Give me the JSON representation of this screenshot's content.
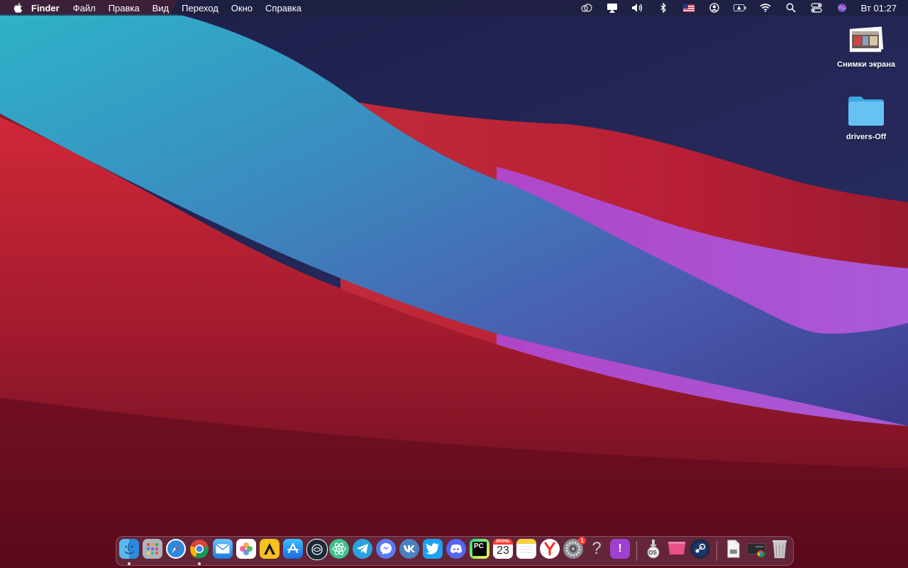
{
  "menubar": {
    "app_name": "Finder",
    "menus": [
      "Файл",
      "Правка",
      "Вид",
      "Переход",
      "Окно",
      "Справка"
    ],
    "status_icons": [
      "creative-cloud-icon",
      "airplay-icon",
      "volume-icon",
      "bluetooth-icon",
      "us-flag-icon",
      "user-icon",
      "battery-icon",
      "wifi-icon",
      "search-icon",
      "control-center-icon",
      "siri-icon"
    ],
    "clock": "Вт 01:27"
  },
  "desktop": {
    "items": [
      {
        "label": "Снимки экрана",
        "icon": "screenshot-stack-icon"
      },
      {
        "label": "drivers-Off",
        "icon": "folder-icon"
      }
    ]
  },
  "dock": {
    "apps": [
      "finder",
      "launchpad",
      "safari",
      "chrome",
      "mail",
      "photos",
      "artstudio",
      "app-store",
      "proxyman",
      "atom",
      "telegram",
      "messenger",
      "vk",
      "twitter",
      "discord",
      "pycharm",
      "calendar",
      "notes",
      "yandex-browser",
      "system-preferences",
      "help",
      "feedback"
    ],
    "calendar": {
      "month": "ИЮНЬ",
      "day": "23"
    },
    "pycharm_label": "PC",
    "system_prefs_badge": "1",
    "help_glyph": "?",
    "feedback_glyph": "!",
    "utilities": [
      "macos-installer",
      "cleanmymac",
      "steam"
    ],
    "installer_label": "OS",
    "others": [
      "downloads-stack",
      "chrome-app-stack",
      "trash"
    ]
  }
}
